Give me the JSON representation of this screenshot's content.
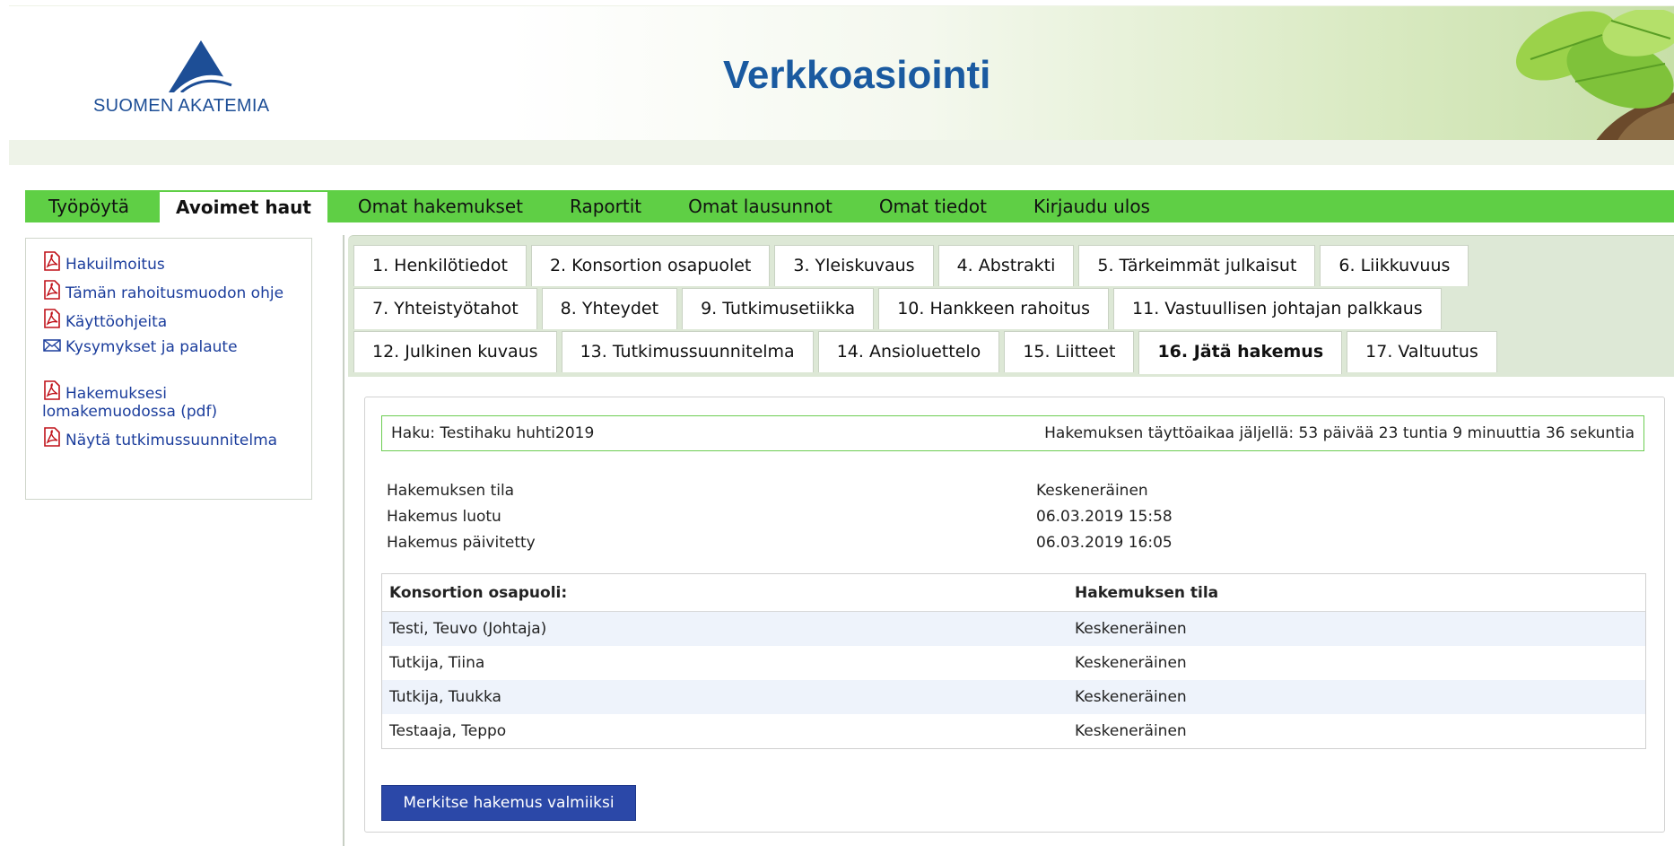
{
  "header": {
    "logo_text": "SUOMEN AKATEMIA",
    "title": "Verkkoasiointi"
  },
  "nav": {
    "items": [
      {
        "label": "Työpöytä",
        "active": false
      },
      {
        "label": "Avoimet haut",
        "active": true
      },
      {
        "label": "Omat hakemukset",
        "active": false
      },
      {
        "label": "Raportit",
        "active": false
      },
      {
        "label": "Omat lausunnot",
        "active": false
      },
      {
        "label": "Omat tiedot",
        "active": false
      },
      {
        "label": "Kirjaudu ulos",
        "active": false
      }
    ]
  },
  "sidebar": {
    "links": [
      {
        "label": "Hakuilmoitus",
        "icon": "pdf-icon"
      },
      {
        "label": "Tämän rahoitusmuodon ohje",
        "icon": "pdf-icon"
      },
      {
        "label": "Käyttöohjeita",
        "icon": "pdf-icon"
      },
      {
        "label": "Kysymykset ja palaute",
        "icon": "mail-icon"
      },
      {
        "label": "Hakemuksesi lomakemuodossa (pdf)",
        "icon": "pdf-icon"
      },
      {
        "label": "Näytä tutkimussuunnitelma",
        "icon": "pdf-icon"
      }
    ]
  },
  "tabs": {
    "rows": [
      [
        "1. Henkilötiedot",
        "2. Konsortion osapuolet",
        "3. Yleiskuvaus",
        "4. Abstrakti",
        "5. Tärkeimmät julkaisut",
        "6. Liikkuvuus"
      ],
      [
        "7. Yhteistyötahot",
        "8. Yhteydet",
        "9. Tutkimusetiikka",
        "10. Hankkeen rahoitus",
        "11. Vastuullisen johtajan palkkaus"
      ],
      [
        "12. Julkinen kuvaus",
        "13. Tutkimussuunnitelma",
        "14. Ansioluettelo",
        "15. Liitteet",
        "16. Jätä hakemus",
        "17. Valtuutus"
      ]
    ],
    "active": "16. Jätä hakemus"
  },
  "call": {
    "name": "Haku: Testihaku huhti2019",
    "time_left": "Hakemuksen täyttöaikaa jäljellä: 53 päivää 23 tuntia 9 minuuttia 36 sekuntia"
  },
  "status": [
    {
      "label": "Hakemuksen tila",
      "value": "Keskeneräinen"
    },
    {
      "label": "Hakemus luotu",
      "value": "06.03.2019 15:58"
    },
    {
      "label": "Hakemus päivitetty",
      "value": "06.03.2019 16:05"
    }
  ],
  "participants": {
    "headers": [
      "Konsortion osapuoli:",
      "Hakemuksen tila"
    ],
    "rows": [
      [
        "Testi, Teuvo (Johtaja)",
        "Keskeneräinen"
      ],
      [
        "Tutkija, Tiina",
        "Keskeneräinen"
      ],
      [
        "Tutkija, Tuukka",
        "Keskeneräinen"
      ],
      [
        "Testaaja, Teppo",
        "Keskeneräinen"
      ]
    ]
  },
  "actions": {
    "submit_label": "Merkitse hakemus valmiiksi"
  },
  "colors": {
    "nav_green": "#5fcf45",
    "brand_blue": "#1a5aa0",
    "link_blue": "#1b3d9c",
    "button_blue": "#2b48a8",
    "pdf_red": "#c0121a"
  }
}
